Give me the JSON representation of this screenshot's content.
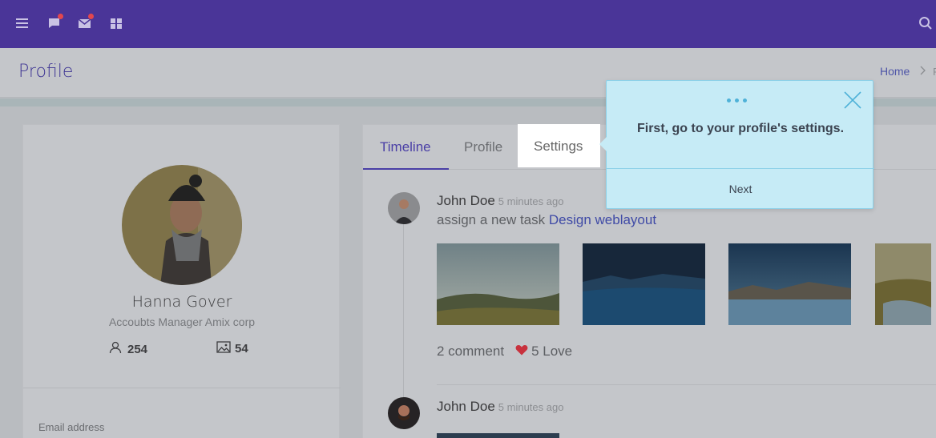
{
  "header": {
    "icons": [
      "menu-icon",
      "chat-icon",
      "mail-icon",
      "apps-icon",
      "search-icon"
    ]
  },
  "page": {
    "title": "Profile",
    "breadcrumb": {
      "home": "Home",
      "current": "P"
    }
  },
  "profile_card": {
    "name": "Hanna Gover",
    "role": "Accoubts Manager Amix corp",
    "followers": "254",
    "photos": "54",
    "email_label": "Email address"
  },
  "tabs": [
    {
      "label": "Timeline",
      "active": true
    },
    {
      "label": "Profile",
      "active": false
    },
    {
      "label": "Settings",
      "active": false
    }
  ],
  "timeline": [
    {
      "author": "John Doe",
      "time": "5 minutes ago",
      "text_prefix": "assign a new task",
      "link": "Design weblayout",
      "comments": "2 comment",
      "love": "5 Love"
    },
    {
      "author": "John Doe",
      "time": "5 minutes ago"
    }
  ],
  "tour": {
    "message": "First, go to your profile's settings.",
    "next_label": "Next"
  },
  "colors": {
    "topbar": "#4a3598",
    "accent": "#4a3fa6",
    "popover_bg": "#c6ebf6",
    "heart": "#e2474e"
  }
}
